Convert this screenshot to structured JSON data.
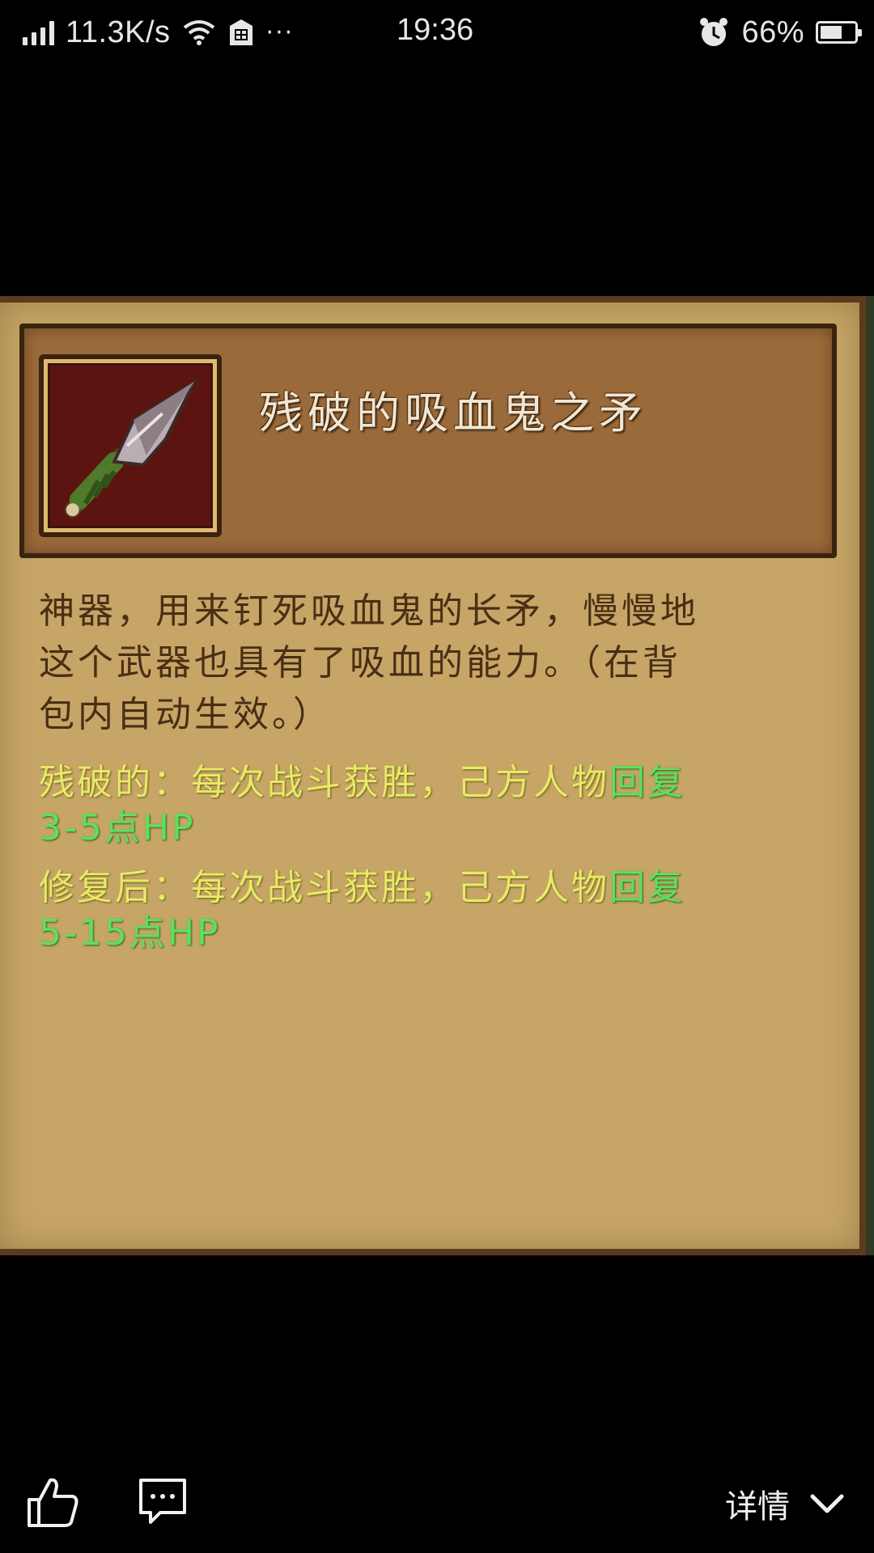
{
  "status_bar": {
    "network_speed": "11.3K/s",
    "more": "···",
    "time": "19:36",
    "battery_pct": "66%",
    "battery_level": 0.66
  },
  "item": {
    "title": "残破的吸血鬼之矛",
    "description_lines": [
      "神器，用来钉死吸血鬼的长矛，慢慢地",
      "这个武器也具有了吸血的能力。（在背",
      "包内自动生效。）"
    ],
    "effects": [
      {
        "line1_yellow": "残破的：每次战斗获胜，己方人物",
        "line1_green": "回复",
        "line2_green": "3-5点HP"
      },
      {
        "line1_yellow": "修复后：每次战斗获胜，己方人物",
        "line1_green": "回复",
        "line2_green": "5-15点HP"
      }
    ],
    "colors": {
      "parchment": "#c6a567",
      "header": "#9b6a3a",
      "text_brown": "#4a2e14",
      "effect_yellow": "#e7ea63",
      "effect_green": "#5fe05a"
    },
    "icon": "spear-icon"
  },
  "bottom_bar": {
    "like_icon": "thumbs-up-icon",
    "comment_icon": "comment-icon",
    "detail_label": "详情",
    "detail_icon": "chevron-down-icon"
  }
}
